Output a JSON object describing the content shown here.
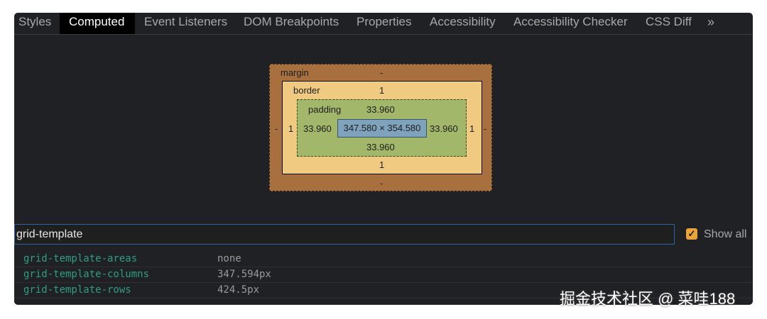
{
  "tabs": [
    {
      "label": "Styles",
      "active": false
    },
    {
      "label": "Computed",
      "active": true
    },
    {
      "label": "Event Listeners",
      "active": false
    },
    {
      "label": "DOM Breakpoints",
      "active": false
    },
    {
      "label": "Properties",
      "active": false
    },
    {
      "label": "Accessibility",
      "active": false
    },
    {
      "label": "Accessibility Checker",
      "active": false
    },
    {
      "label": "CSS Diff",
      "active": false
    }
  ],
  "tabs_more": "»",
  "box_model": {
    "margin": {
      "label": "margin",
      "top": "-",
      "bottom": "-",
      "left": "-",
      "right": "-"
    },
    "border": {
      "label": "border",
      "top": "1",
      "bottom": "1",
      "left": "1",
      "right": "1"
    },
    "padding": {
      "label": "padding",
      "top": "33.960",
      "bottom": "33.960",
      "left": "33.960",
      "right": "33.960"
    },
    "content": "347.580 × 354.580"
  },
  "filter": {
    "value": "grid-template"
  },
  "show_all": {
    "label": "Show all",
    "checked": true,
    "check_glyph": "✓"
  },
  "properties": [
    {
      "name": "grid-template-areas",
      "value": "none"
    },
    {
      "name": "grid-template-columns",
      "value": "347.594px"
    },
    {
      "name": "grid-template-rows",
      "value": "424.5px"
    }
  ],
  "watermark": "掘金技术社区 @ 菜哇188",
  "colors": {
    "panel_bg": "#202124",
    "margin": "#a8703f",
    "border": "#f0ca80",
    "padding": "#a3b76a",
    "content": "#7fa3bd",
    "prop_name": "#2f9e86",
    "checkbox": "#e8a33a"
  }
}
